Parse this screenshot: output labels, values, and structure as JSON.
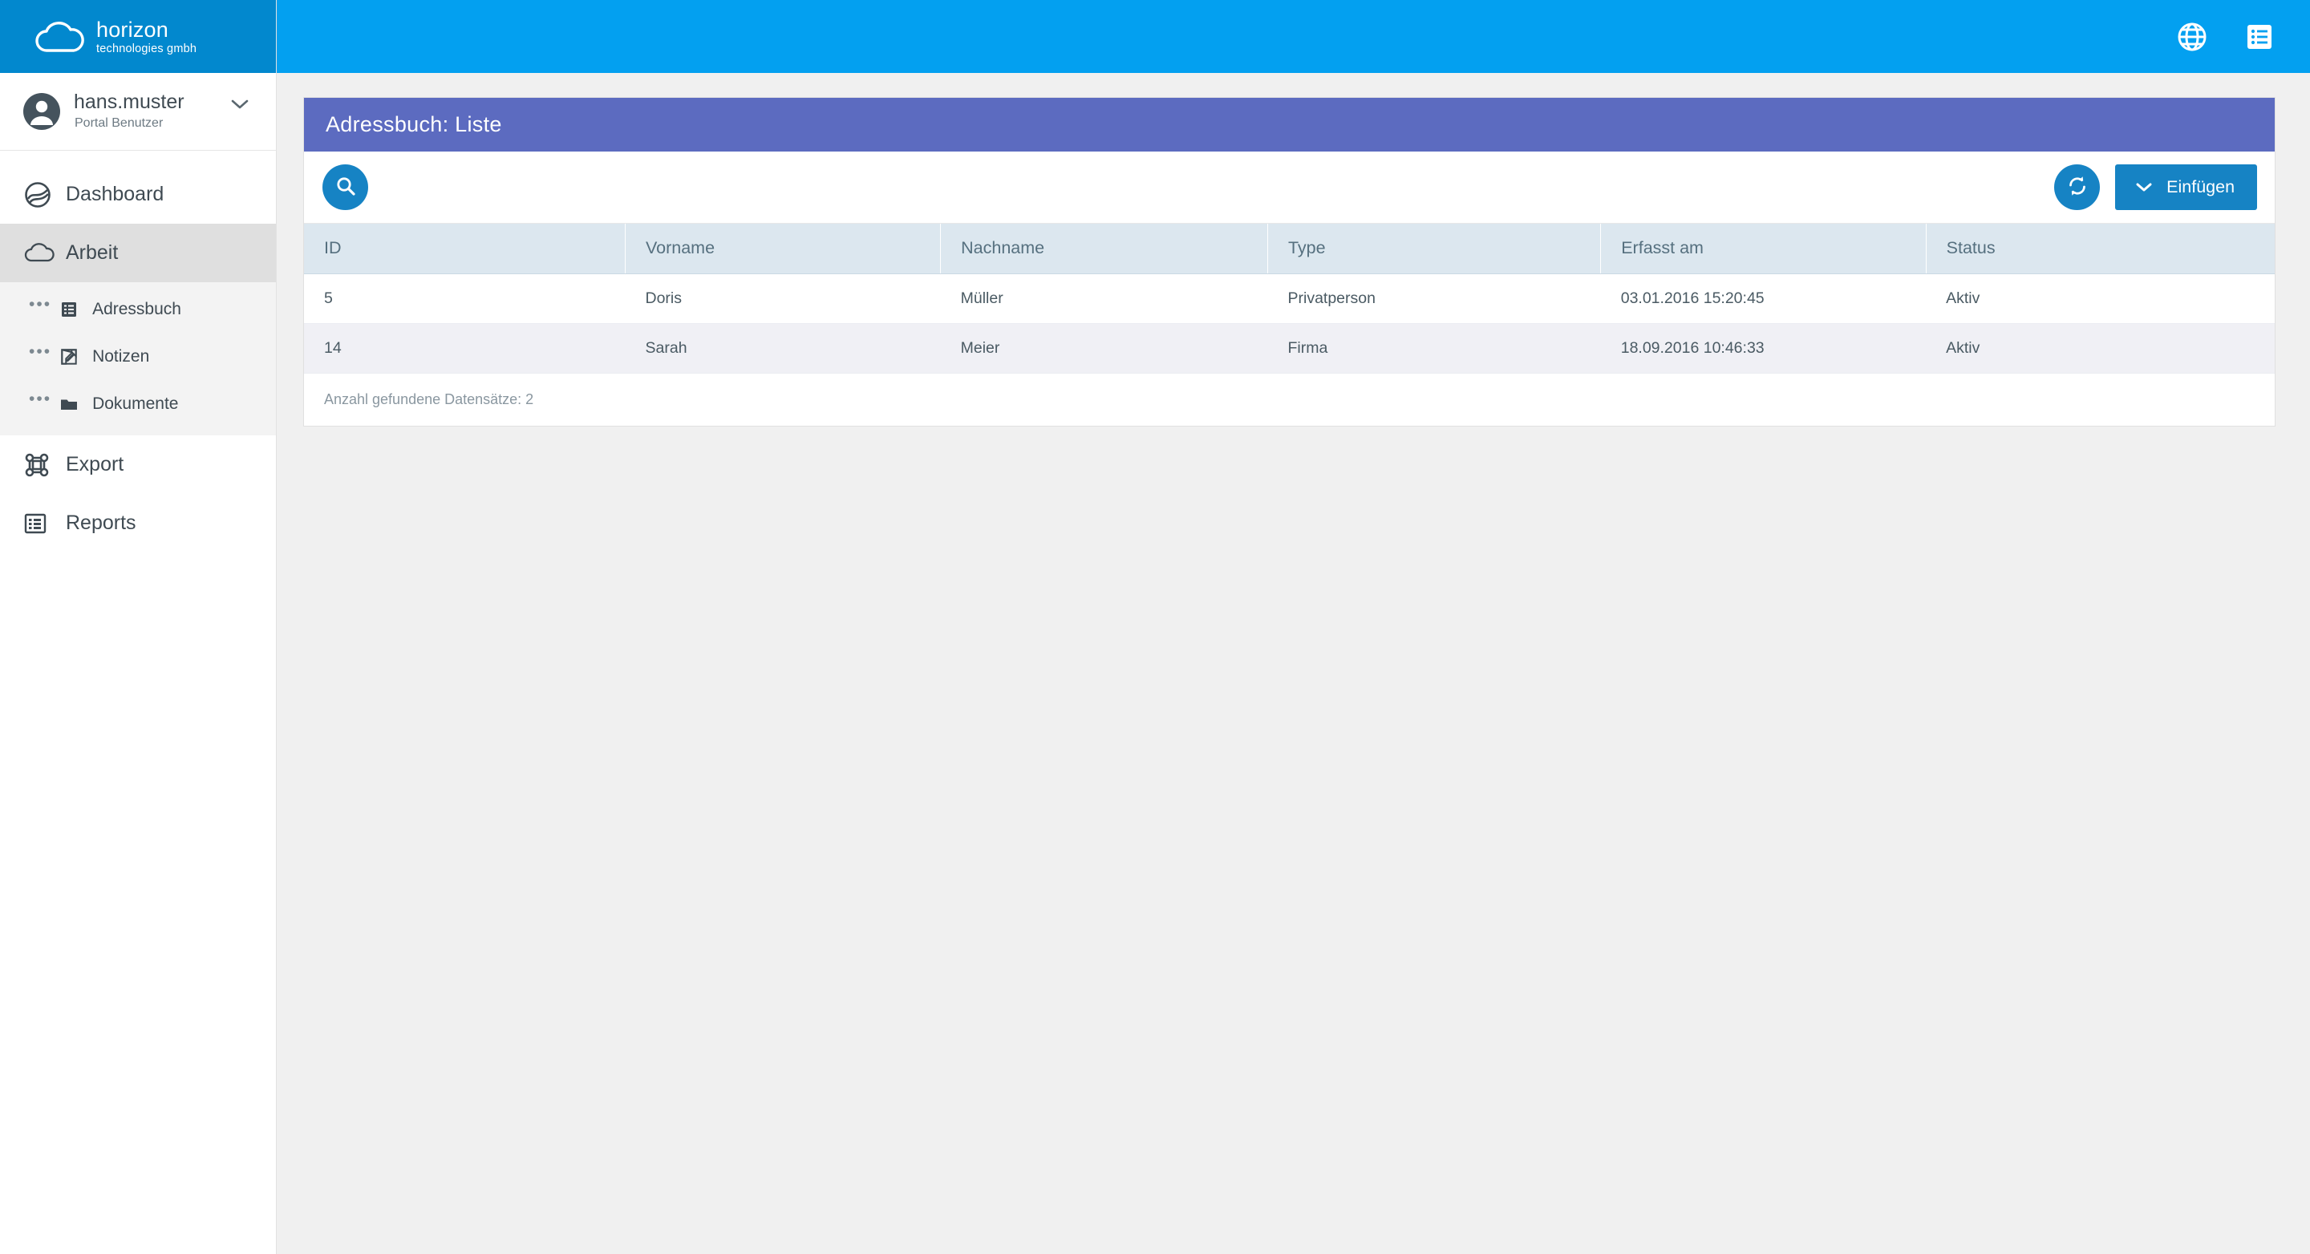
{
  "brand": {
    "name": "horizon",
    "tagline": "technologies gmbh",
    "logo_icon": "cloud-icon",
    "logo_bg": "#0288ce"
  },
  "topbar": {
    "bg": "#03a0f0",
    "icons": [
      {
        "name": "globe-icon",
        "label": "Sprache"
      },
      {
        "name": "list-menu-icon",
        "label": "Menü"
      }
    ]
  },
  "user": {
    "name": "hans.muster",
    "role": "Portal Benutzer",
    "avatar_icon": "avatar-icon",
    "caret_icon": "chevron-down-icon"
  },
  "sidebar": {
    "items": [
      {
        "label": "Dashboard",
        "icon": "dashboard-globe-icon",
        "active": false
      },
      {
        "label": "Arbeit",
        "icon": "cloud-outline-icon",
        "active": true
      },
      {
        "label": "Export",
        "icon": "command-icon",
        "active": false
      },
      {
        "label": "Reports",
        "icon": "report-table-icon",
        "active": false
      }
    ],
    "subitems": [
      {
        "label": "Adressbuch",
        "icon": "address-list-icon"
      },
      {
        "label": "Notizen",
        "icon": "edit-note-icon"
      },
      {
        "label": "Dokumente",
        "icon": "folder-icon"
      }
    ],
    "active_bg": "#dfdfdf",
    "sub_bg": "#f3f3f3"
  },
  "panel": {
    "title": "Adressbuch: Liste",
    "header_bg": "#5c6bc0",
    "toolbar": {
      "search_label": "Suchen",
      "search_icon": "search-icon",
      "refresh_label": "Aktualisieren",
      "refresh_icon": "refresh-icon",
      "insert_label": "Einfügen",
      "insert_caret_icon": "chevron-down-icon",
      "button_bg": "#1683c4"
    },
    "table": {
      "columns": [
        "ID",
        "Vorname",
        "Nachname",
        "Type",
        "Erfasst am",
        "Status"
      ],
      "rows": [
        [
          "5",
          "Doris",
          "Müller",
          "Privatperson",
          "03.01.2016 15:20:45",
          "Aktiv"
        ],
        [
          "14",
          "Sarah",
          "Meier",
          "Firma",
          "18.09.2016 10:46:33",
          "Aktiv"
        ]
      ],
      "header_bg": "#dce7ef",
      "alt_row_bg": "#f0f0f5"
    },
    "footer": "Anzahl gefundene Datensätze: 2"
  }
}
